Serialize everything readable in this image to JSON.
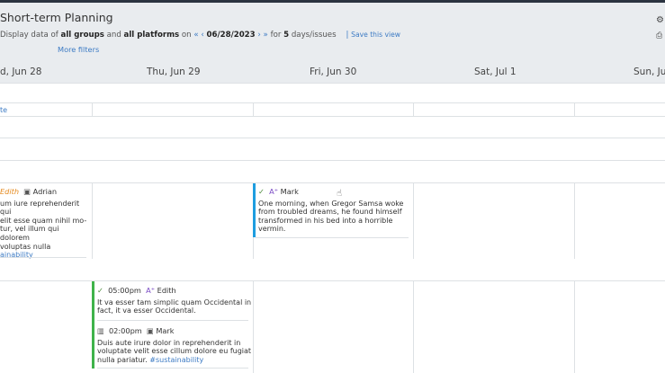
{
  "page": {
    "title": "Short-term Planning",
    "subline": {
      "prefix": "Display data of",
      "groups": "all groups",
      "and": "and",
      "platforms": "all platforms",
      "on": "on",
      "nav_prev": "« ‹",
      "date": "06/28/2023",
      "nav_next": "› »",
      "for": "for",
      "days": "5",
      "unit": "days/issues",
      "separator": "|",
      "save_view": "Save this view"
    },
    "more_filters": "More filters"
  },
  "days": [
    {
      "label": "d, Jun 28"
    },
    {
      "label": "Thu, Jun 29"
    },
    {
      "label": "Fri, Jun 30"
    },
    {
      "label": "Sat, Jul 1"
    },
    {
      "label": "Sun, Jul"
    }
  ],
  "row_link_partial": "te",
  "cards": {
    "wed_1": {
      "author": "Edith",
      "assignee": "Adrian",
      "lines": [
        "um iure reprehenderit qui",
        "elit esse quam nihil mo-",
        "tur, vel illum qui dolorem",
        "voluptas nulla"
      ],
      "tag": "ainability"
    },
    "fri_1": {
      "assignee": "Mark",
      "lines": [
        "One morning, when Gregor Samsa woke",
        "from troubled dreams, he found himself",
        "transformed in his bed into a horrible",
        "vermin."
      ]
    },
    "thu_1": {
      "time": "05:00pm",
      "assignee": "Edith",
      "lines": [
        "It va esser tam simplic quam Occidental in",
        "fact, it va esser Occidental."
      ]
    },
    "thu_2": {
      "time": "02:00pm",
      "assignee": "Mark",
      "lines": [
        "Duis aute irure dolor in reprehenderit in",
        "voluptate velit esse cillum dolore eu fugiat",
        "nulla pariatur."
      ],
      "tag": "#sustainability"
    }
  },
  "colors": {
    "accent_blue": "#3d7bc4",
    "bar_blue": "#1e9de0",
    "bar_green": "#3fb34a",
    "orange": "#e58a1f",
    "header_bg": "#e9ecef"
  }
}
